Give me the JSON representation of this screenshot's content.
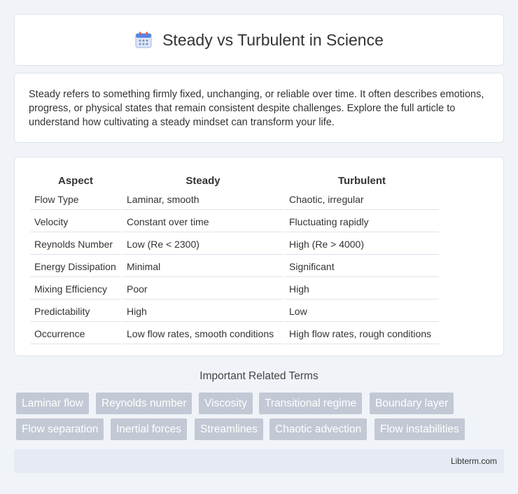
{
  "header": {
    "title": "Steady vs Turbulent in Science",
    "logo_icon": "calendar-icon"
  },
  "intro": {
    "text": "Steady refers to something firmly fixed, unchanging, or reliable over time. It often describes emotions, progress, or physical states that remain consistent despite challenges. Explore the full article to understand how cultivating a steady mindset can transform your life."
  },
  "table": {
    "headers": [
      "Aspect",
      "Steady",
      "Turbulent"
    ],
    "rows": [
      [
        "Flow Type",
        "Laminar, smooth",
        "Chaotic, irregular"
      ],
      [
        "Velocity",
        "Constant over time",
        "Fluctuating rapidly"
      ],
      [
        "Reynolds Number",
        "Low (Re < 2300)",
        "High (Re > 4000)"
      ],
      [
        "Energy Dissipation",
        "Minimal",
        "Significant"
      ],
      [
        "Mixing Efficiency",
        "Poor",
        "High"
      ],
      [
        "Predictability",
        "High",
        "Low"
      ],
      [
        "Occurrence",
        "Low flow rates, smooth conditions",
        "High flow rates, rough conditions"
      ]
    ]
  },
  "related": {
    "title": "Important Related Terms",
    "tags": [
      "Laminar flow",
      "Reynolds number",
      "Viscosity",
      "Transitional regime",
      "Boundary layer",
      "Flow separation",
      "Inertial forces",
      "Streamlines",
      "Chaotic advection",
      "Flow instabilities"
    ]
  },
  "footer": {
    "text": "Libterm.com"
  },
  "colors": {
    "background": "#f0f3f8",
    "tag_bg": "#c2c8d4",
    "footer_bg": "#e5eaf4"
  }
}
